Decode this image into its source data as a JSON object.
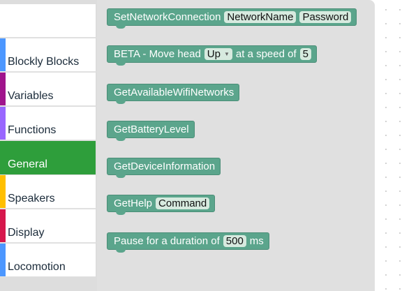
{
  "toolbox": {
    "categories": [
      {
        "label": "",
        "color": "#ffffff"
      },
      {
        "label": "Blockly Blocks",
        "color": "#4c97ff"
      },
      {
        "label": "Variables",
        "color": "#a0148c"
      },
      {
        "label": "Functions",
        "color": "#9966ff"
      },
      {
        "label": "General",
        "color": "#2e9e3b"
      },
      {
        "label": "Speakers",
        "color": "#ffbf00"
      },
      {
        "label": "Display",
        "color": "#d6174c"
      },
      {
        "label": "Locomotion",
        "color": "#4c97ff"
      }
    ],
    "selected": "General"
  },
  "flyout": {
    "blocks": {
      "set_network": {
        "text": "SetNetworkConnection",
        "arg1": "NetworkName",
        "arg2": "Password"
      },
      "move_head": {
        "text1": "BETA - Move head",
        "dropdown": "Up",
        "text2": "at a speed of",
        "value": "5"
      },
      "get_wifi": {
        "text": "GetAvailableWifiNetworks"
      },
      "get_battery": {
        "text": "GetBatteryLevel"
      },
      "get_device": {
        "text": "GetDeviceInformation"
      },
      "get_help": {
        "text": "GetHelp",
        "arg": "Command"
      },
      "pause": {
        "text1": "Pause for a duration of",
        "value": "500",
        "text2": "ms"
      }
    }
  },
  "colors": {
    "block": "#5ba58c",
    "field": "#d7eadf"
  }
}
